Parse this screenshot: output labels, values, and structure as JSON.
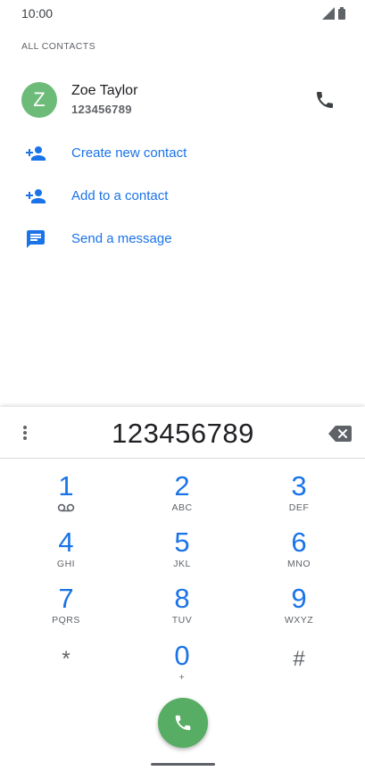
{
  "status": {
    "time": "10:00",
    "signal_icon": "signal-icon",
    "battery_icon": "battery-icon"
  },
  "section": {
    "label": "ALL CONTACTS"
  },
  "contact": {
    "avatar_letter": "Z",
    "name": "Zoe Taylor",
    "number": "123456789",
    "avatar_color": "#6dbb78"
  },
  "actions": [
    {
      "label": "Create new contact",
      "icon": "person-add-icon"
    },
    {
      "label": "Add to a contact",
      "icon": "person-add-icon"
    },
    {
      "label": "Send a message",
      "icon": "message-icon"
    }
  ],
  "dialpad": {
    "digits": "123456789",
    "keys": [
      {
        "digit": "1",
        "letters": ""
      },
      {
        "digit": "2",
        "letters": "ABC"
      },
      {
        "digit": "3",
        "letters": "DEF"
      },
      {
        "digit": "4",
        "letters": "GHI"
      },
      {
        "digit": "5",
        "letters": "JKL"
      },
      {
        "digit": "6",
        "letters": "MNO"
      },
      {
        "digit": "7",
        "letters": "PQRS"
      },
      {
        "digit": "8",
        "letters": "TUV"
      },
      {
        "digit": "9",
        "letters": "WXYZ"
      },
      {
        "digit": "*",
        "letters": ""
      },
      {
        "digit": "0",
        "letters": "+"
      },
      {
        "digit": "#",
        "letters": ""
      }
    ]
  },
  "colors": {
    "accent": "#1a73e8",
    "call_button": "#57ad63"
  }
}
